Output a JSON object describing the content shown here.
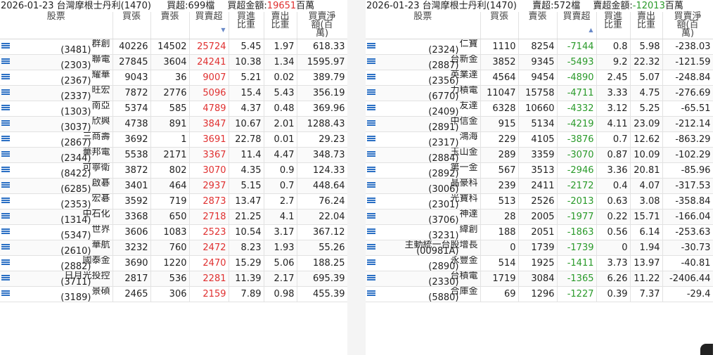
{
  "left": {
    "header": {
      "date_title": "2026-01-23 台灣摩根士丹利(1470)",
      "count_label": "買超:699檔",
      "amount_label": "買超金額:",
      "amount_value": "19651",
      "amount_unit": "百萬"
    },
    "columns": [
      "股票",
      "買張",
      "賣張",
      "買賣超",
      "買進比重",
      "賣出比重",
      "買賣淨額(百萬)"
    ],
    "rows": [
      {
        "name": "群創",
        "code": "(3481)",
        "buy": "40226",
        "sell": "14502",
        "net": "25724",
        "bp": "5.45",
        "sp": "1.97",
        "amt": "618.33"
      },
      {
        "name": "聯電",
        "code": "(2303)",
        "buy": "27845",
        "sell": "3604",
        "net": "24241",
        "bp": "10.38",
        "sp": "1.34",
        "amt": "1595.97"
      },
      {
        "name": "耀華",
        "code": "(2367)",
        "buy": "9043",
        "sell": "36",
        "net": "9007",
        "bp": "5.21",
        "sp": "0.02",
        "amt": "389.79"
      },
      {
        "name": "旺宏",
        "code": "(2337)",
        "buy": "7872",
        "sell": "2776",
        "net": "5096",
        "bp": "15.4",
        "sp": "5.43",
        "amt": "356.19"
      },
      {
        "name": "南亞",
        "code": "(1303)",
        "buy": "5374",
        "sell": "585",
        "net": "4789",
        "bp": "4.37",
        "sp": "0.48",
        "amt": "369.96"
      },
      {
        "name": "欣興",
        "code": "(3037)",
        "buy": "4738",
        "sell": "891",
        "net": "3847",
        "bp": "10.67",
        "sp": "2.01",
        "amt": "1288.43"
      },
      {
        "name": "三商壽",
        "code": "(2867)",
        "buy": "3692",
        "sell": "1",
        "net": "3691",
        "bp": "22.78",
        "sp": "0.01",
        "amt": "29.23"
      },
      {
        "name": "華邦電",
        "code": "(2344)",
        "buy": "5538",
        "sell": "2171",
        "net": "3367",
        "bp": "11.4",
        "sp": "4.47",
        "amt": "348.73"
      },
      {
        "name": "可寧衛",
        "code": "(8422)",
        "buy": "3872",
        "sell": "802",
        "net": "3070",
        "bp": "4.35",
        "sp": "0.9",
        "amt": "124.33"
      },
      {
        "name": "啟碁",
        "code": "(6285)",
        "buy": "3401",
        "sell": "464",
        "net": "2937",
        "bp": "5.15",
        "sp": "0.7",
        "amt": "448.64"
      },
      {
        "name": "宏碁",
        "code": "(2353)",
        "buy": "3592",
        "sell": "719",
        "net": "2873",
        "bp": "13.47",
        "sp": "2.7",
        "amt": "76.24"
      },
      {
        "name": "中石化",
        "code": "(1314)",
        "buy": "3368",
        "sell": "650",
        "net": "2718",
        "bp": "21.25",
        "sp": "4.1",
        "amt": "22.04"
      },
      {
        "name": "世界",
        "code": "(5347)",
        "buy": "3606",
        "sell": "1083",
        "net": "2523",
        "bp": "10.54",
        "sp": "3.17",
        "amt": "367.12"
      },
      {
        "name": "華航",
        "code": "(2610)",
        "buy": "3232",
        "sell": "760",
        "net": "2472",
        "bp": "8.23",
        "sp": "1.93",
        "amt": "55.26"
      },
      {
        "name": "國泰金",
        "code": "(2882)",
        "buy": "3690",
        "sell": "1220",
        "net": "2470",
        "bp": "15.29",
        "sp": "5.06",
        "amt": "188.25"
      },
      {
        "name": "日月光投控",
        "code": "(3711)",
        "buy": "2817",
        "sell": "536",
        "net": "2281",
        "bp": "11.39",
        "sp": "2.17",
        "amt": "695.39"
      },
      {
        "name": "景碩",
        "code": "(3189)",
        "buy": "2465",
        "sell": "306",
        "net": "2159",
        "bp": "7.89",
        "sp": "0.98",
        "amt": "455.39"
      }
    ]
  },
  "right": {
    "header": {
      "date_title": "2026-01-23 台灣摩根士丹利(1470)",
      "count_label": "賣超:572檔",
      "amount_label": "賣超金額:",
      "amount_value": "-12013",
      "amount_unit": "百萬"
    },
    "columns": [
      "股票",
      "買張",
      "賣張",
      "買賣超",
      "買進比重",
      "賣出比重",
      "買賣淨額(百萬)"
    ],
    "rows": [
      {
        "name": "仁寶",
        "code": "(2324)",
        "buy": "1110",
        "sell": "8254",
        "net": "-7144",
        "bp": "0.8",
        "sp": "5.98",
        "amt": "-238.03"
      },
      {
        "name": "台新金",
        "code": "(2887)",
        "buy": "3852",
        "sell": "9345",
        "net": "-5493",
        "bp": "9.2",
        "sp": "22.32",
        "amt": "-121.59"
      },
      {
        "name": "英業達",
        "code": "(2356)",
        "buy": "4564",
        "sell": "9454",
        "net": "-4890",
        "bp": "2.45",
        "sp": "5.07",
        "amt": "-248.84"
      },
      {
        "name": "力積電",
        "code": "(6770)",
        "buy": "11047",
        "sell": "15758",
        "net": "-4711",
        "bp": "3.33",
        "sp": "4.75",
        "amt": "-276.69"
      },
      {
        "name": "友達",
        "code": "(2409)",
        "buy": "6328",
        "sell": "10660",
        "net": "-4332",
        "bp": "3.12",
        "sp": "5.25",
        "amt": "-65.51"
      },
      {
        "name": "中信金",
        "code": "(2891)",
        "buy": "915",
        "sell": "5134",
        "net": "-4219",
        "bp": "4.11",
        "sp": "23.09",
        "amt": "-212.14"
      },
      {
        "name": "鴻海",
        "code": "(2317)",
        "buy": "229",
        "sell": "4105",
        "net": "-3876",
        "bp": "0.7",
        "sp": "12.62",
        "amt": "-863.29"
      },
      {
        "name": "玉山金",
        "code": "(2884)",
        "buy": "289",
        "sell": "3359",
        "net": "-3070",
        "bp": "0.87",
        "sp": "10.09",
        "amt": "-102.29"
      },
      {
        "name": "第一金",
        "code": "(2892)",
        "buy": "567",
        "sell": "3513",
        "net": "-2946",
        "bp": "3.36",
        "sp": "20.81",
        "amt": "-85.96"
      },
      {
        "name": "晶豪科",
        "code": "(3006)",
        "buy": "239",
        "sell": "2411",
        "net": "-2172",
        "bp": "0.4",
        "sp": "4.07",
        "amt": "-317.53"
      },
      {
        "name": "光寶科",
        "code": "(2301)",
        "buy": "513",
        "sell": "2526",
        "net": "-2013",
        "bp": "0.63",
        "sp": "3.08",
        "amt": "-358.84"
      },
      {
        "name": "神達",
        "code": "(3706)",
        "buy": "28",
        "sell": "2005",
        "net": "-1977",
        "bp": "0.22",
        "sp": "15.71",
        "amt": "-166.04"
      },
      {
        "name": "緯創",
        "code": "(3231)",
        "buy": "188",
        "sell": "2051",
        "net": "-1863",
        "bp": "0.56",
        "sp": "6.14",
        "amt": "-253.63"
      },
      {
        "name": "主動統一台股增長",
        "code": "(00981A)",
        "buy": "0",
        "sell": "1739",
        "net": "-1739",
        "bp": "0",
        "sp": "1.94",
        "amt": "-30.73"
      },
      {
        "name": "永豐金",
        "code": "(2890)",
        "buy": "514",
        "sell": "1925",
        "net": "-1411",
        "bp": "3.73",
        "sp": "13.97",
        "amt": "-40.81"
      },
      {
        "name": "台積電",
        "code": "(2330)",
        "buy": "1719",
        "sell": "3084",
        "net": "-1365",
        "bp": "6.26",
        "sp": "11.22",
        "amt": "-2406.44"
      },
      {
        "name": "合庫金",
        "code": "(5880)",
        "buy": "69",
        "sell": "1296",
        "net": "-1227",
        "bp": "0.39",
        "sp": "7.37",
        "amt": "-29.4"
      }
    ]
  },
  "colors": {
    "positive": "#e03030",
    "negative": "#2a9a2a",
    "icon": "#2a6fc4"
  },
  "icons": {
    "row_icon": "list-icon",
    "sort_icon": "sort-arrow-icon"
  }
}
